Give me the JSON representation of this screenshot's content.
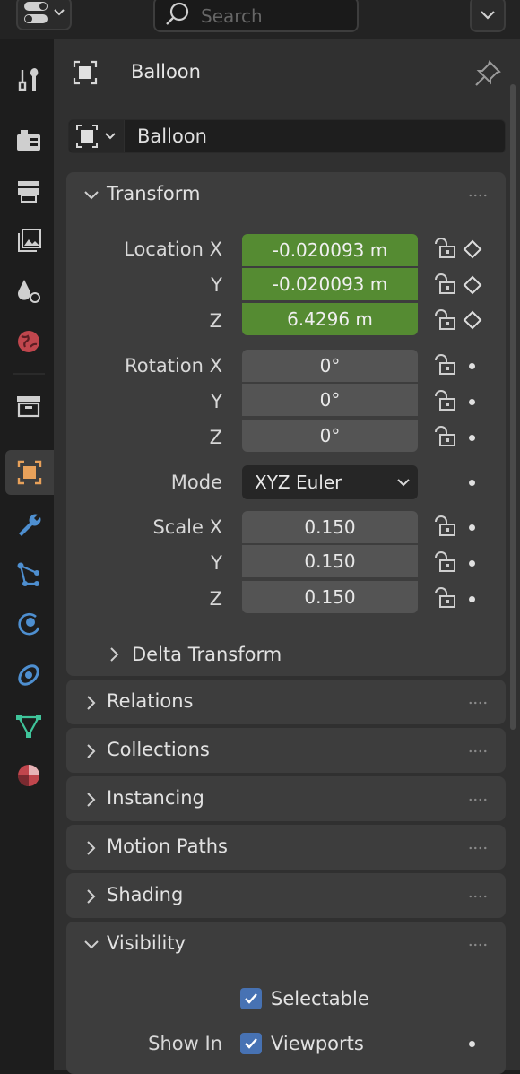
{
  "header": {
    "search_placeholder": "Search"
  },
  "tabs": [
    {
      "id": "tool",
      "icon": "tool-icon"
    },
    {
      "id": "render",
      "icon": "render-icon"
    },
    {
      "id": "output",
      "icon": "output-icon"
    },
    {
      "id": "view-layer",
      "icon": "view-layer-icon"
    },
    {
      "id": "scene",
      "icon": "scene-icon"
    },
    {
      "id": "world",
      "icon": "world-icon"
    },
    {
      "id": "collection",
      "icon": "collection-icon"
    },
    {
      "id": "object",
      "icon": "object-icon",
      "active": true
    },
    {
      "id": "modifiers",
      "icon": "wrench-icon"
    },
    {
      "id": "particles",
      "icon": "particles-icon"
    },
    {
      "id": "physics",
      "icon": "physics-icon"
    },
    {
      "id": "constraints",
      "icon": "constraints-icon"
    },
    {
      "id": "data",
      "icon": "mesh-data-icon"
    },
    {
      "id": "material",
      "icon": "material-icon"
    }
  ],
  "context": {
    "name": "Balloon"
  },
  "object_field": {
    "name": "Balloon"
  },
  "transform": {
    "title": "Transform",
    "location": {
      "label_x": "Location X",
      "label_y": "Y",
      "label_z": "Z",
      "x": "-0.020093 m",
      "y": "-0.020093 m",
      "z": "6.4296 m"
    },
    "rotation": {
      "label_x": "Rotation X",
      "label_y": "Y",
      "label_z": "Z",
      "x": "0°",
      "y": "0°",
      "z": "0°"
    },
    "mode": {
      "label": "Mode",
      "value": "XYZ Euler"
    },
    "scale": {
      "label_x": "Scale X",
      "label_y": "Y",
      "label_z": "Z",
      "x": "0.150",
      "y": "0.150",
      "z": "0.150"
    },
    "delta": "Delta Transform"
  },
  "panels": {
    "relations": "Relations",
    "collections": "Collections",
    "instancing": "Instancing",
    "motion_paths": "Motion Paths",
    "shading": "Shading",
    "visibility": "Visibility"
  },
  "visibility": {
    "selectable": "Selectable",
    "show_in": "Show In",
    "viewports": "Viewports"
  },
  "colors": {
    "animated_field": "#558b32",
    "checkbox": "#4772b3",
    "active_tab_icon": "#e8a15a"
  }
}
